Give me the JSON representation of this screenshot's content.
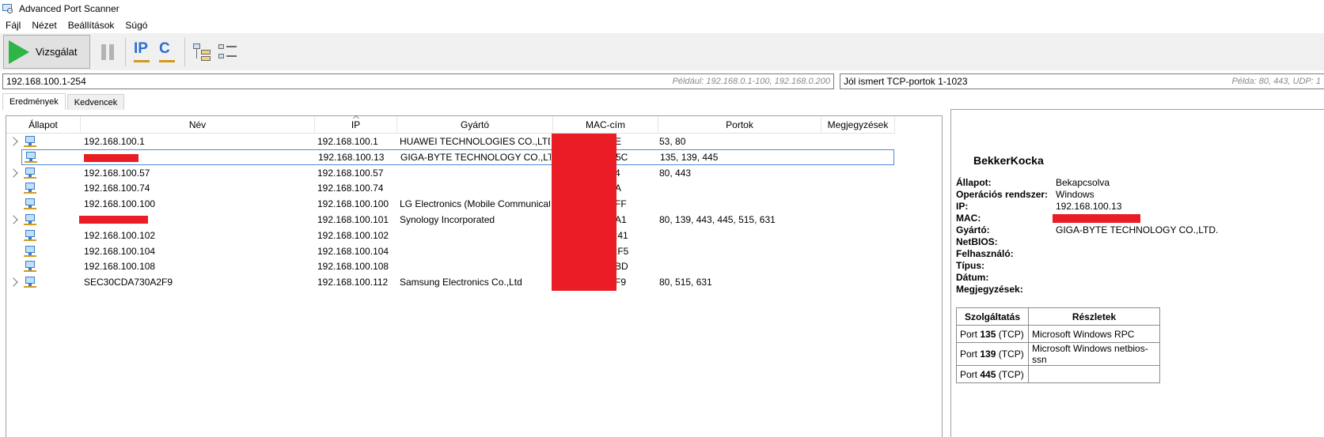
{
  "window": {
    "title": "Advanced Port Scanner"
  },
  "menu": [
    "Fájl",
    "Nézet",
    "Beállítások",
    "Súgó"
  ],
  "toolbar": {
    "scan_label": "Vizsgálat"
  },
  "ip_range": {
    "value": "192.168.100.1-254",
    "hint": "Például: 192.168.0.1-100, 192.168.0.200"
  },
  "ports": {
    "value": "Jól ismert TCP-portok 1-1023",
    "hint": "Példa: 80, 443, UDP: 1"
  },
  "tabs": [
    "Eredmények",
    "Kedvencek"
  ],
  "columns": [
    "Állapot",
    "Név",
    "IP",
    "Gyártó",
    "MAC-cím",
    "Portok",
    "Megjegyzések"
  ],
  "rows": [
    {
      "name": "192.168.100.1",
      "ip": "192.168.100.1",
      "vendor": "HUAWEI TECHNOLOGIES CO.,LTD",
      "mac": "E",
      "ports": "53, 80",
      "expandable": true,
      "selected": false,
      "name_redacted": false
    },
    {
      "name": "",
      "ip": "192.168.100.13",
      "vendor": "GIGA-BYTE TECHNOLOGY CO.,LTD.",
      "mac": "5C",
      "ports": "135, 139, 445",
      "expandable": false,
      "selected": true,
      "name_redacted": true
    },
    {
      "name": "192.168.100.57",
      "ip": "192.168.100.57",
      "vendor": "",
      "mac": "4",
      "ports": "80, 443",
      "expandable": true,
      "selected": false,
      "name_redacted": false
    },
    {
      "name": "192.168.100.74",
      "ip": "192.168.100.74",
      "vendor": "",
      "mac": "A",
      "ports": "",
      "expandable": false,
      "selected": false,
      "name_redacted": false
    },
    {
      "name": "192.168.100.100",
      "ip": "192.168.100.100",
      "vendor": "LG Electronics (Mobile Communicat...",
      "mac": "FF",
      "ports": "",
      "expandable": false,
      "selected": false,
      "name_redacted": false
    },
    {
      "name": "",
      "ip": "192.168.100.101",
      "vendor": "Synology Incorporated",
      "mac": "A1",
      "ports": "80, 139, 443, 445, 515, 631",
      "expandable": true,
      "selected": false,
      "name_redacted": true
    },
    {
      "name": "192.168.100.102",
      "ip": "192.168.100.102",
      "vendor": "",
      "mac": ":41",
      "ports": "",
      "expandable": false,
      "selected": false,
      "name_redacted": false
    },
    {
      "name": "192.168.100.104",
      "ip": "192.168.100.104",
      "vendor": "",
      "mac": ":F5",
      "ports": "",
      "expandable": false,
      "selected": false,
      "name_redacted": false
    },
    {
      "name": "192.168.100.108",
      "ip": "192.168.100.108",
      "vendor": "",
      "mac": "BD",
      "ports": "",
      "expandable": false,
      "selected": false,
      "name_redacted": false
    },
    {
      "name": "SEC30CDA730A2F9",
      "ip": "192.168.100.112",
      "vendor": "Samsung Electronics Co.,Ltd",
      "mac": "F9",
      "ports": "80, 515, 631",
      "expandable": true,
      "selected": false,
      "name_redacted": false
    }
  ],
  "details": {
    "name": "BekkerKocka",
    "fields": [
      {
        "key": "Állapot:",
        "value": "Bekapcsolva"
      },
      {
        "key": "Operációs rendszer:",
        "value": "Windows"
      },
      {
        "key": "IP:",
        "value": "192.168.100.13"
      },
      {
        "key": "MAC:",
        "value": "",
        "redacted": true
      },
      {
        "key": "Gyártó:",
        "value": "GIGA-BYTE TECHNOLOGY CO.,LTD."
      },
      {
        "key": "NetBIOS:",
        "value": ""
      },
      {
        "key": "Felhasználó:",
        "value": ""
      },
      {
        "key": "Típus:",
        "value": ""
      },
      {
        "key": "Dátum:",
        "value": ""
      },
      {
        "key": "Megjegyzések:",
        "value": ""
      }
    ],
    "services_headers": [
      "Szolgáltatás",
      "Részletek"
    ],
    "services": [
      {
        "port_prefix": "Port",
        "port": "135",
        "proto": "(TCP)",
        "detail": "Microsoft Windows RPC"
      },
      {
        "port_prefix": "Port",
        "port": "139",
        "proto": "(TCP)",
        "detail": "Microsoft Windows netbios-ssn"
      },
      {
        "port_prefix": "Port",
        "port": "445",
        "proto": "(TCP)",
        "detail": ""
      }
    ]
  },
  "colors": {
    "redaction": "#ea1d26",
    "selection_border": "#4a8ad6",
    "play": "#2fb545",
    "accent": "#2a6fd1"
  }
}
